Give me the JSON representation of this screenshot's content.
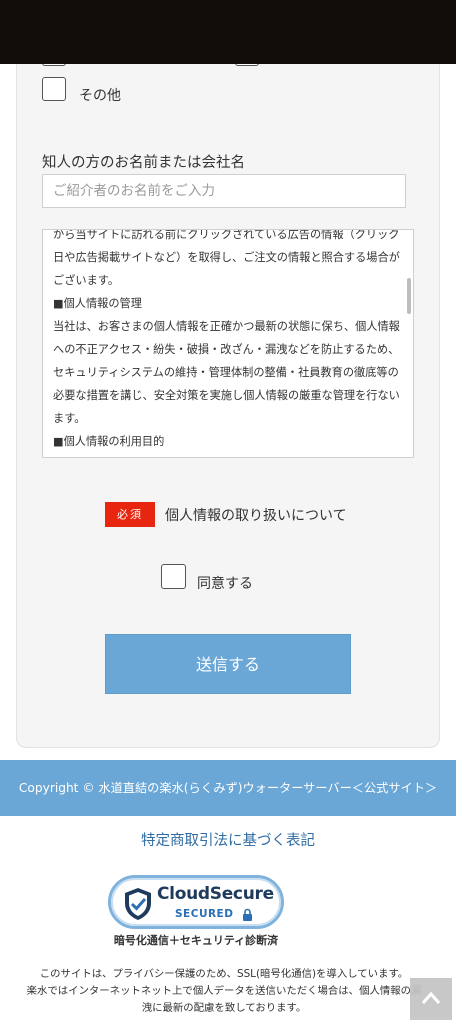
{
  "form": {
    "other_option_label": "その他",
    "referrer_label": "知人の方のお名前または会社名",
    "referrer_placeholder": "ご紹介者のお名前をご入力",
    "privacy_paragraphs": [
      "から当サイトに訪れる前にクリックされている広告の情報（クリック日や広告掲載サイトなど）を取得し、ご注文の情報と照合する場合がございます。",
      "■個人情報の管理",
      "当社は、お客さまの個人情報を正確かつ最新の状態に保ち、個人情報への不正アクセス・紛失・破損・改ざん・漏洩などを防止するため、セキュリティシステムの維持・管理体制の整備・社員教育の徹底等の必要な措置を講じ、安全対策を実施し個人情報の厳重な管理を行ないます。",
      "■個人情報の利用目的"
    ],
    "required_badge": "必須",
    "privacy_title": "個人情報の取り扱いについて",
    "agree_label": "同意する",
    "submit_label": "送信する"
  },
  "footer": {
    "copyright": "Copyright ©  水道直結の楽水(らくみず)ウォーターサーバー＜公式サイト＞",
    "legal_link": "特定商取引法に基づく表記",
    "seal_title": "CloudSecure",
    "seal_subtitle": "SECURED",
    "seal_caption": "暗号化通信＋セキュリティ診断済",
    "notice_line1": "このサイトは、プライバシー保護のため、SSL(暗号化通信)を導入しています。",
    "notice_line2": "楽水ではインターネットネット上で個人データを送信いただく場合は、個人情報の漏",
    "notice_line3": "洩に最新の配慮を致しております。"
  },
  "colors": {
    "accent": "#6aa7d6",
    "required": "#e8250e",
    "link": "#2f6ca3",
    "status_bar": "#120d0a"
  },
  "icons": [
    "checkbox-icon",
    "cloudsecure-shield-icon",
    "lock-icon",
    "chevron-up-icon"
  ]
}
